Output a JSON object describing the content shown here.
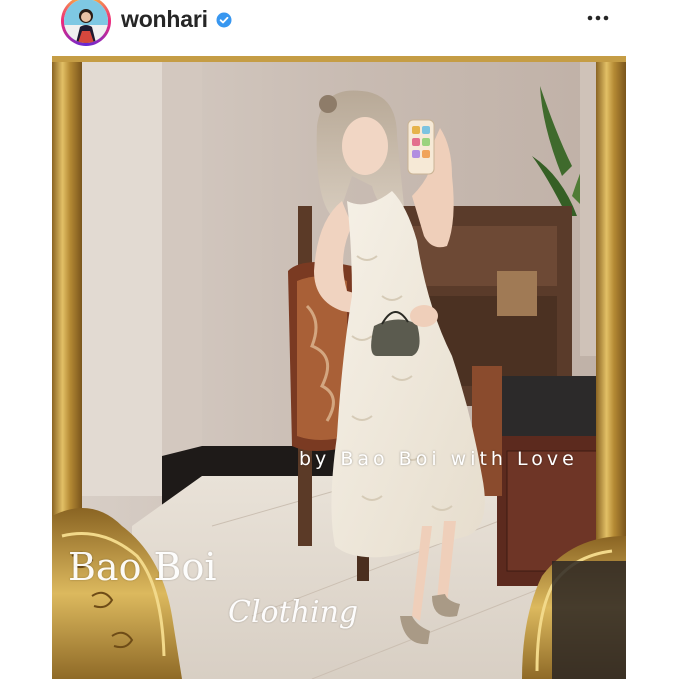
{
  "post": {
    "username": "wonhari",
    "verified": true,
    "more_icon": "more-options-icon",
    "verified_icon": "verified-badge-icon"
  },
  "photo": {
    "overlay_caption": "by Bao Boi with Love",
    "brand_name": "Bao Boi",
    "brand_tagline": "Clothing"
  },
  "colors": {
    "verified_blue": "#3897f0",
    "username_text": "#262626",
    "frame_gold": "#b8913c"
  }
}
